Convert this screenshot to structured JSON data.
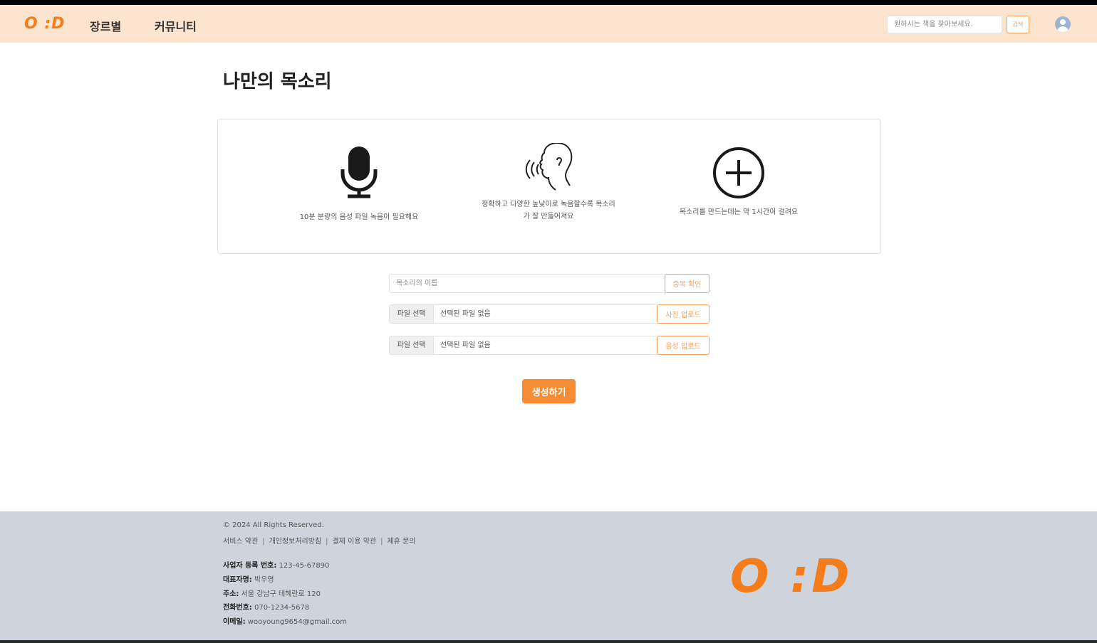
{
  "header": {
    "logo": "O :D",
    "nav": [
      "장르별",
      "커뮤니티"
    ],
    "search_placeholder": "원하시는 책을 찾아보세요.",
    "search_button": "검색"
  },
  "page": {
    "title": "나만의 목소리"
  },
  "info_card": {
    "items": [
      {
        "icon": "microphone-icon",
        "text_lines": [
          "10분 분량의 음성 파일 녹음이 필요해요"
        ]
      },
      {
        "icon": "speaking-head-icon",
        "text_lines": [
          "정확하고 다양한 높낮이로 녹음할수록 목소리",
          "가 잘 만들어져요"
        ]
      },
      {
        "icon": "plus-circle-icon",
        "text_lines": [
          "목소리를 만드는데는 약 1시간이 걸려요"
        ]
      }
    ]
  },
  "form": {
    "name_placeholder": "목소리의 이름",
    "dup_check_button": "중복 확인",
    "file_choose_label": "파일 선택",
    "no_file_text": "선택된 파일 없음",
    "photo_upload_button": "사진 업로드",
    "audio_upload_button": "음성 업로드",
    "create_button": "생성하기"
  },
  "footer": {
    "copyright": "© 2024 All Rights Reserved.",
    "links": [
      "서비스 약관",
      "개인정보처리방침",
      "결제 이용 약관",
      "제휴 문의"
    ],
    "biz": [
      {
        "label": "사업자 등록 번호:",
        "value": "123-45-67890"
      },
      {
        "label": "대표자명:",
        "value": "박우영"
      },
      {
        "label": "주소:",
        "value": "서울 강남구 테헤란로 120"
      },
      {
        "label": "전화번호:",
        "value": "070-1234-5678"
      },
      {
        "label": "이메일:",
        "value": "wooyoung9654@gmail.com"
      }
    ],
    "logo": "O :D"
  },
  "colors": {
    "accent": "#f68d35",
    "header_bg": "#fde4cf",
    "footer_bg": "#cfd4dc"
  }
}
